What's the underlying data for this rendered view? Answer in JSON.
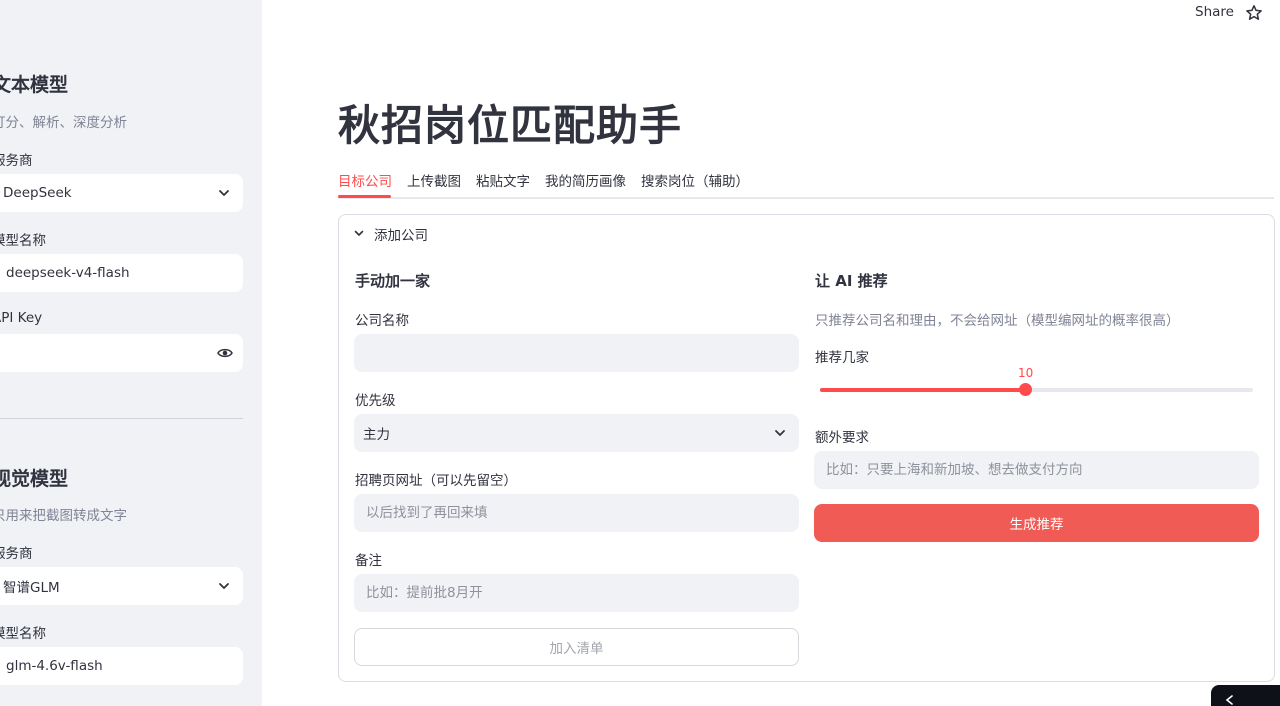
{
  "sidebar": {
    "text_model": {
      "title": "文本模型",
      "caption": "打分、解析、深度分析",
      "provider_label": "服务商",
      "provider_value": "DeepSeek",
      "model_label": "模型名称",
      "model_value": "deepseek-v4-flash",
      "apikey_label": "API Key",
      "apikey_value": ""
    },
    "vision_model": {
      "title": "视觉模型",
      "caption": "只用来把截图转成文字",
      "provider_label": "服务商",
      "provider_value": "智谱GLM",
      "model_label": "模型名称",
      "model_value": "glm-4.6v-flash"
    }
  },
  "toolbar": {
    "share_label": "Share"
  },
  "page": {
    "title": "秋招岗位匹配助手"
  },
  "tabs": [
    {
      "label": "目标公司",
      "active": true
    },
    {
      "label": "上传截图",
      "active": false
    },
    {
      "label": "粘贴文字",
      "active": false
    },
    {
      "label": "我的简历画像",
      "active": false
    },
    {
      "label": "搜索岗位（辅助）",
      "active": false
    }
  ],
  "expander": {
    "label": "添加公司"
  },
  "manual": {
    "title": "手动加一家",
    "company_label": "公司名称",
    "company_value": "",
    "priority_label": "优先级",
    "priority_value": "主力",
    "url_label": "招聘页网址（可以先留空）",
    "url_placeholder": "以后找到了再回来填",
    "note_label": "备注",
    "note_placeholder": "比如：提前批8月开",
    "add_button": "加入清单"
  },
  "ai": {
    "title": "让 AI 推荐",
    "caption": "只推荐公司名和理由，不会给网址（模型编网址的概率很高）",
    "count_label": "推荐几家",
    "count_value": 10,
    "count_min": 1,
    "count_max": 20,
    "extra_label": "额外要求",
    "extra_placeholder": "比如：只要上海和新加坡、想去做支付方向",
    "generate_button": "生成推荐"
  },
  "colors": {
    "accent": "#ff4b4b",
    "primary_button": "#f05b55",
    "sidebar_bg": "#f0f2f6"
  }
}
